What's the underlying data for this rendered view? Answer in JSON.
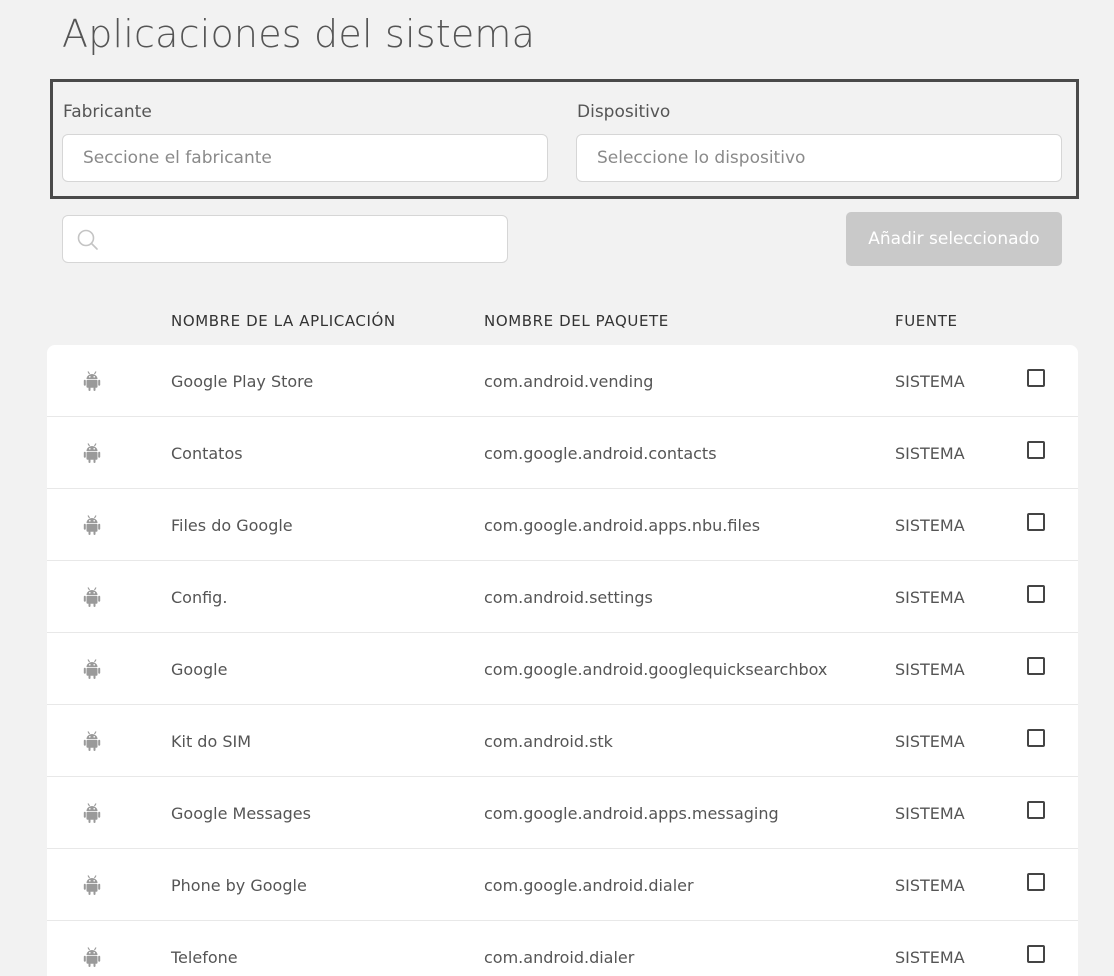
{
  "page": {
    "title": "Aplicaciones del sistema"
  },
  "filters": {
    "manufacturer": {
      "label": "Fabricante",
      "placeholder": "Seccione el fabricante"
    },
    "device": {
      "label": "Dispositivo",
      "placeholder": "Seleccione lo dispositivo"
    }
  },
  "search": {
    "placeholder": "",
    "value": ""
  },
  "actions": {
    "add_selected_label": "Añadir seleccionado"
  },
  "table": {
    "headers": {
      "app_name": "NOMBRE DE LA APLICACIÓN",
      "package_name": "NOMBRE DEL PAQUETE",
      "source": "FUENTE"
    },
    "rows": [
      {
        "icon": "android-icon",
        "app_name": "Google Play Store",
        "package_name": "com.android.vending",
        "source": "SISTEMA",
        "checked": false
      },
      {
        "icon": "android-icon",
        "app_name": "Contatos",
        "package_name": "com.google.android.contacts",
        "source": "SISTEMA",
        "checked": false
      },
      {
        "icon": "android-icon",
        "app_name": "Files do Google",
        "package_name": "com.google.android.apps.nbu.files",
        "source": "SISTEMA",
        "checked": false
      },
      {
        "icon": "android-icon",
        "app_name": "Config.",
        "package_name": "com.android.settings",
        "source": "SISTEMA",
        "checked": false
      },
      {
        "icon": "android-icon",
        "app_name": "Google",
        "package_name": "com.google.android.googlequicksearchbox",
        "source": "SISTEMA",
        "checked": false
      },
      {
        "icon": "android-icon",
        "app_name": "Kit do SIM",
        "package_name": "com.android.stk",
        "source": "SISTEMA",
        "checked": false
      },
      {
        "icon": "android-icon",
        "app_name": "Google Messages",
        "package_name": "com.google.android.apps.messaging",
        "source": "SISTEMA",
        "checked": false
      },
      {
        "icon": "android-icon",
        "app_name": "Phone by Google",
        "package_name": "com.google.android.dialer",
        "source": "SISTEMA",
        "checked": false
      },
      {
        "icon": "android-icon",
        "app_name": "Telefone",
        "package_name": "com.android.dialer",
        "source": "SISTEMA",
        "checked": false
      }
    ]
  },
  "colors": {
    "background": "#f2f2f2",
    "card": "#ffffff",
    "button_disabled": "#c9c9c9",
    "icon_gray": "#9a9a9a",
    "filter_border": "#4a4a4a"
  }
}
